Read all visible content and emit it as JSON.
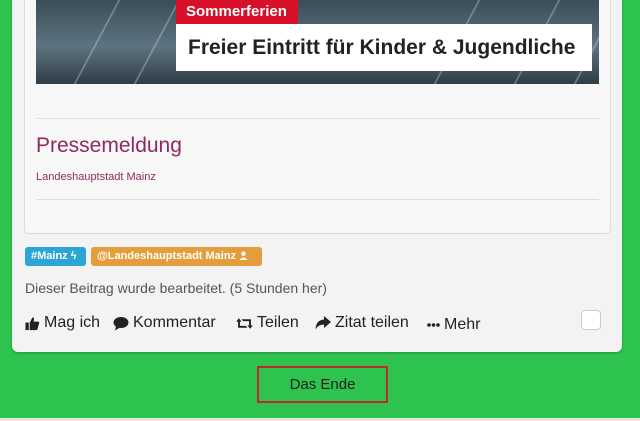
{
  "post": {
    "banner": {
      "tag": "Sommerferien",
      "headline": "Freier Eintritt für Kinder & Jugendliche"
    },
    "title": "Pressemeldung",
    "source": "Landeshauptstadt Mainz",
    "tags": [
      {
        "label": "#Mainz",
        "color": "#2aa5d6",
        "icon": "lightning-icon"
      },
      {
        "label": "@Landeshauptstadt Mainz",
        "color": "#e39d3c",
        "icon": "user-icon"
      }
    ],
    "edited_notice": "Dieser Beitrag wurde bearbeitet. (5 Stunden her)",
    "actions": {
      "like": "Mag ich",
      "comment": "Kommentar",
      "share": "Teilen",
      "quote": "Zitat teilen",
      "more": "Mehr"
    }
  },
  "footer": {
    "end_label": "Das Ende"
  },
  "colors": {
    "background": "#2ec24f",
    "title": "#8e2a5e",
    "end_border": "#c0282a"
  }
}
